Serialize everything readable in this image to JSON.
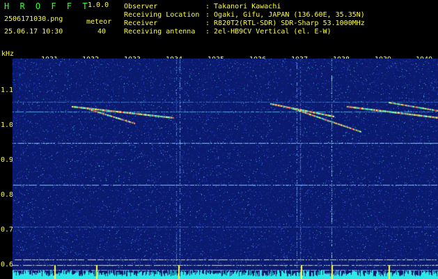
{
  "header": {
    "app_title": "H R O F F T",
    "version": "1.0.0",
    "filename": "2506171030.png",
    "meteor_label": "meteor",
    "timestamp": "25.06.17 10:30",
    "meteor_count": "40"
  },
  "station_info": [
    {
      "label": "Observer",
      "value": ": Takanori Kawachi"
    },
    {
      "label": "Receiving Location",
      "value": ": Ogaki, Gifu, JAPAN (136.60E, 35.35N)"
    },
    {
      "label": "Receiver",
      "value": ": R820T2(RTL-SDR) SDR-Sharp 53.1000MHz"
    },
    {
      "label": "Receiving antenna",
      "value": ": 2el-HB9CV Vertical (el. E-W)"
    }
  ],
  "spectrogram": {
    "y_unit": "kHz",
    "x_ticks": [
      "1031",
      "1032",
      "1033",
      "1034",
      "1035",
      "1036",
      "1037",
      "1038",
      "1039",
      "1040"
    ],
    "y_ticks": [
      "1.1",
      "1.0",
      "0.9",
      "0.8",
      "0.7",
      "0.6"
    ],
    "background_color": "#0a1a6e",
    "label_color": "#ffff33"
  }
}
